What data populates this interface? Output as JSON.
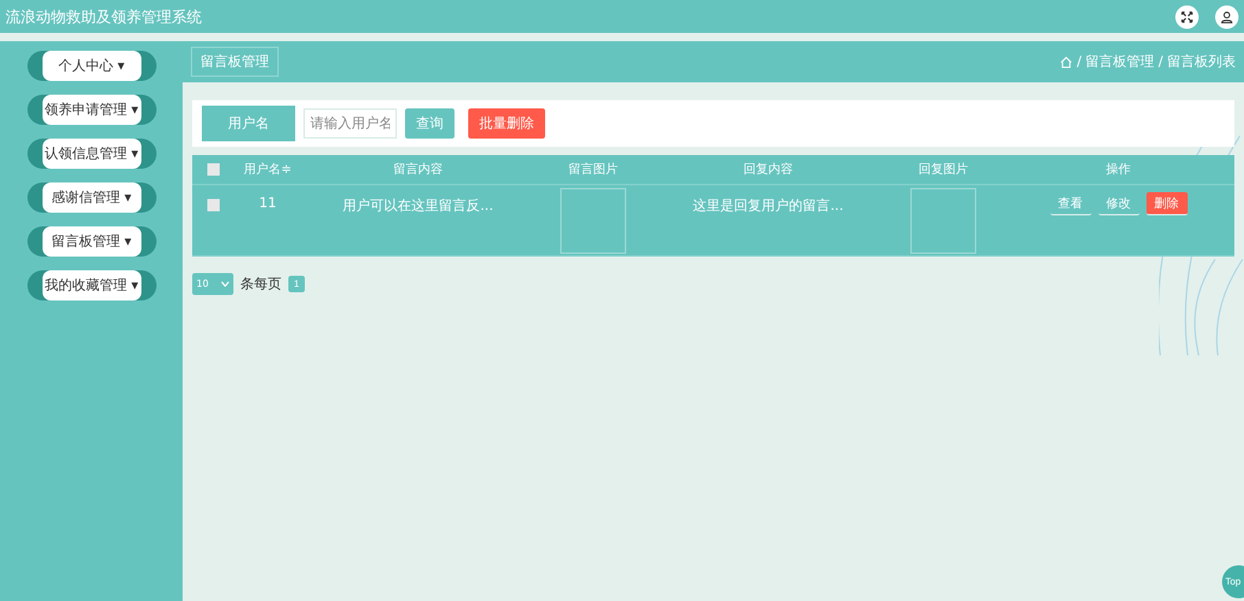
{
  "header": {
    "title": "流浪动物救助及领养管理系统"
  },
  "sidebar": {
    "items": [
      {
        "label": "个人中心",
        "caret": "▾"
      },
      {
        "label": "领养申请管理",
        "caret": "▾"
      },
      {
        "label": "认领信息管理",
        "caret": "▾"
      },
      {
        "label": "感谢信管理",
        "caret": "▾"
      },
      {
        "label": "留言板管理",
        "caret": "▾"
      },
      {
        "label": "我的收藏管理",
        "caret": "▾"
      }
    ]
  },
  "page_title": "留言板管理",
  "breadcrumb": {
    "separator": "/",
    "items": [
      "留言板管理",
      "留言板列表"
    ]
  },
  "search": {
    "label": "用户名",
    "placeholder": "请输入用户名",
    "query_button": "查询",
    "batch_delete_button": "批量删除"
  },
  "table": {
    "select_all_checked": false,
    "columns": [
      "用户名",
      "留言内容",
      "留言图片",
      "回复内容",
      "回复图片",
      "操作"
    ],
    "sort_mark": "≑",
    "rows": [
      {
        "checked": false,
        "cells": [
          "11",
          "用户可以在这里留言反...",
          "",
          "这里是回复用户的留言...",
          ""
        ],
        "actions": [
          "查看",
          "修改",
          "删除"
        ]
      }
    ]
  },
  "pagination": {
    "page_size": "10",
    "per_page_label": "条每页",
    "pages": [
      {
        "label": "1",
        "selected": true
      }
    ]
  },
  "top_button": "Top"
}
